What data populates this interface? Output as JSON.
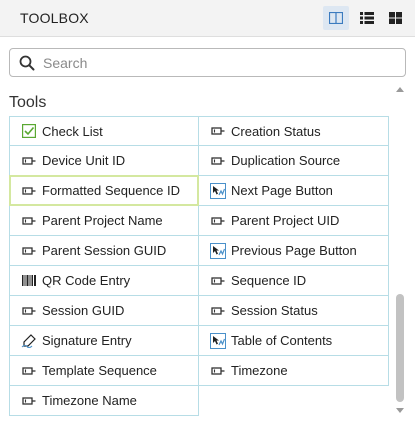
{
  "header": {
    "title": "TOOLBOX"
  },
  "view_modes": [
    {
      "icon": "columns-icon",
      "active": true
    },
    {
      "icon": "list-icon",
      "active": false
    },
    {
      "icon": "grid-icon",
      "active": false
    }
  ],
  "search": {
    "placeholder": "Search",
    "value": ""
  },
  "section": {
    "title": "Tools"
  },
  "tools": [
    {
      "label": "Check List",
      "icon": "checkbox-icon"
    },
    {
      "label": "Creation Status",
      "icon": "input-field-icon"
    },
    {
      "label": "Device Unit ID",
      "icon": "input-field-icon"
    },
    {
      "label": "Duplication Source",
      "icon": "input-field-icon"
    },
    {
      "label": "Formatted Sequence ID",
      "icon": "input-field-icon",
      "selected": true
    },
    {
      "label": "Next Page Button",
      "icon": "hyperlink-icon"
    },
    {
      "label": "Parent Project Name",
      "icon": "input-field-icon"
    },
    {
      "label": "Parent Project UID",
      "icon": "input-field-icon"
    },
    {
      "label": "Parent Session GUID",
      "icon": "input-field-icon"
    },
    {
      "label": "Previous Page Button",
      "icon": "hyperlink-icon"
    },
    {
      "label": "QR Code Entry",
      "icon": "barcode-icon"
    },
    {
      "label": "Sequence ID",
      "icon": "input-field-icon"
    },
    {
      "label": "Session GUID",
      "icon": "input-field-icon"
    },
    {
      "label": "Session Status",
      "icon": "input-field-icon"
    },
    {
      "label": "Signature Entry",
      "icon": "signature-icon"
    },
    {
      "label": "Table of Contents",
      "icon": "hyperlink-icon"
    },
    {
      "label": "Template Sequence",
      "icon": "input-field-icon"
    },
    {
      "label": "Timezone",
      "icon": "input-field-icon"
    },
    {
      "label": "Timezone Name",
      "icon": "input-field-icon"
    }
  ],
  "colors": {
    "tile_border": "#b7dde6",
    "selected_border": "#d4e8a0",
    "active_view": "#dde7f2",
    "icon_blue": "#4a90c9",
    "check_green": "#5aa832"
  }
}
